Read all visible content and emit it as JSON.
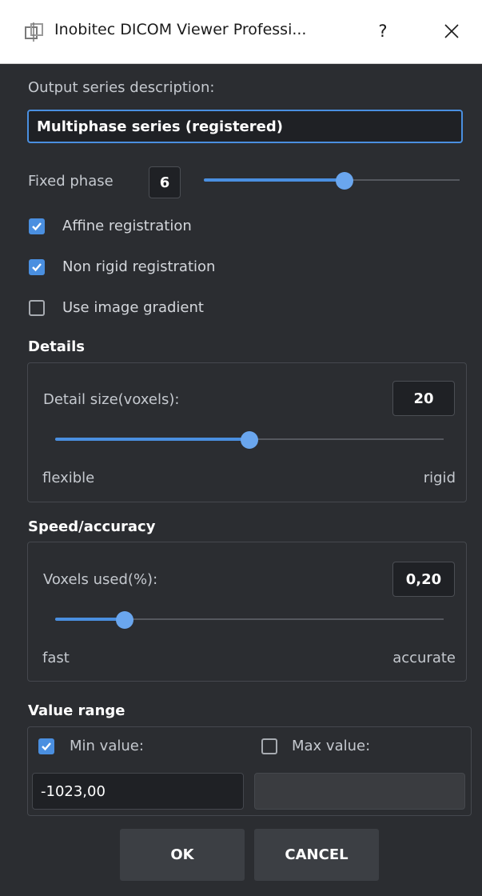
{
  "window": {
    "title": "Inobitec DICOM Viewer Professi...",
    "help_label": "?",
    "close_label": "✕"
  },
  "output": {
    "label": "Output series description:",
    "value": "Multiphase series (registered)"
  },
  "fixed_phase": {
    "label": "Fixed phase",
    "value": "6",
    "slider_fraction": 0.55
  },
  "options": [
    {
      "label": "Affine registration",
      "checked": true
    },
    {
      "label": "Non rigid registration",
      "checked": true
    },
    {
      "label": "Use image gradient",
      "checked": false
    }
  ],
  "details": {
    "title": "Details",
    "detail_size_label": "Detail size(voxels):",
    "detail_size_value": "20",
    "slider_fraction": 0.5,
    "left_label": "flexible",
    "right_label": "rigid"
  },
  "speed": {
    "title": "Speed/accuracy",
    "voxels_label": "Voxels used(%):",
    "voxels_value": "0,20",
    "slider_fraction": 0.18,
    "left_label": "fast",
    "right_label": "accurate"
  },
  "value_range": {
    "title": "Value range",
    "min_label": "Min value:",
    "min_checked": true,
    "min_value": "-1023,00",
    "max_label": "Max value:",
    "max_checked": false,
    "max_value": ""
  },
  "buttons": {
    "ok": "OK",
    "cancel": "CANCEL"
  },
  "colors": {
    "accent": "#4a8fe0",
    "background": "#2b2d31"
  }
}
